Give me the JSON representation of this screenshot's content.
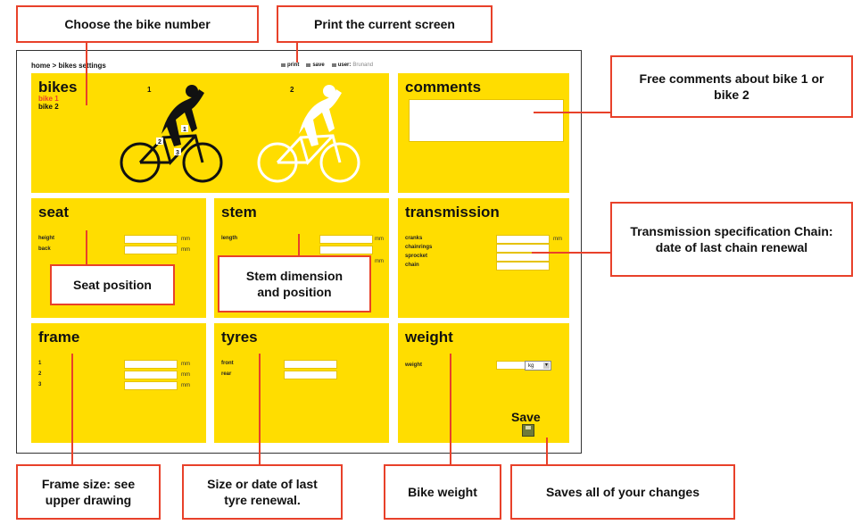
{
  "callouts": {
    "bike_number": "Choose the bike number",
    "print": "Print the current screen",
    "comments": "Free comments about bike 1 or bike 2",
    "transmission": "Transmission specification Chain: date of last chain renewal",
    "seat": "Seat position",
    "stem": "Stem dimension and position",
    "frame": "Frame size: see upper drawing",
    "tyres": "Size or date of last tyre renewal.",
    "weight": "Bike weight",
    "save": "Saves all of your changes"
  },
  "topbar": {
    "breadcrumb": "home > bikes settings",
    "print": "print",
    "save": "save",
    "user_label": "user:",
    "user_name": "Brunand"
  },
  "bikes": {
    "title": "bikes",
    "items": [
      "bike 1",
      "bike 2"
    ],
    "drawing_numbers": [
      "1",
      "2"
    ],
    "body_markers": [
      "1",
      "2",
      "3"
    ]
  },
  "comments": {
    "title": "comments",
    "value": ""
  },
  "seat": {
    "title": "seat",
    "rows": [
      {
        "label": "height",
        "unit": "mm"
      },
      {
        "label": "back",
        "unit": "mm"
      }
    ]
  },
  "stem": {
    "title": "stem",
    "rows": [
      {
        "label": "length",
        "unit": "mm"
      },
      {
        "label": "",
        "unit": "mm"
      }
    ]
  },
  "transmission": {
    "title": "transmission",
    "rows": [
      {
        "label": "cranks",
        "unit": "mm"
      },
      {
        "label": "chainrings",
        "unit": ""
      },
      {
        "label": "sprocket",
        "unit": ""
      },
      {
        "label": "chain",
        "unit": ""
      }
    ]
  },
  "frame": {
    "title": "frame",
    "rows": [
      {
        "label": "1",
        "unit": "mm"
      },
      {
        "label": "2",
        "unit": "mm"
      },
      {
        "label": "3",
        "unit": "mm"
      }
    ]
  },
  "tyres": {
    "title": "tyres",
    "rows": [
      {
        "label": "front"
      },
      {
        "label": "rear"
      }
    ]
  },
  "weight": {
    "title": "weight",
    "label": "weight",
    "unit_selected": "kg",
    "save_label": "Save"
  },
  "colors": {
    "panel": "#ffdd00",
    "accent": "#e8412a",
    "callout_border": "#e8412a"
  }
}
